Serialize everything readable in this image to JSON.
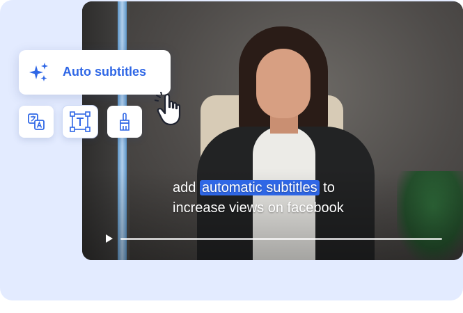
{
  "feature": {
    "auto_subtitles_label": "Auto subtitles",
    "accent_color": "#2f67e6"
  },
  "toolbar": {
    "items": [
      {
        "icon": "translate-icon"
      },
      {
        "icon": "text-box-icon"
      },
      {
        "icon": "brush-icon"
      }
    ]
  },
  "video": {
    "subtitle": {
      "before": "add",
      "highlight": "automatic subtitles",
      "after": "to",
      "line2": "increase views on facebook"
    }
  }
}
